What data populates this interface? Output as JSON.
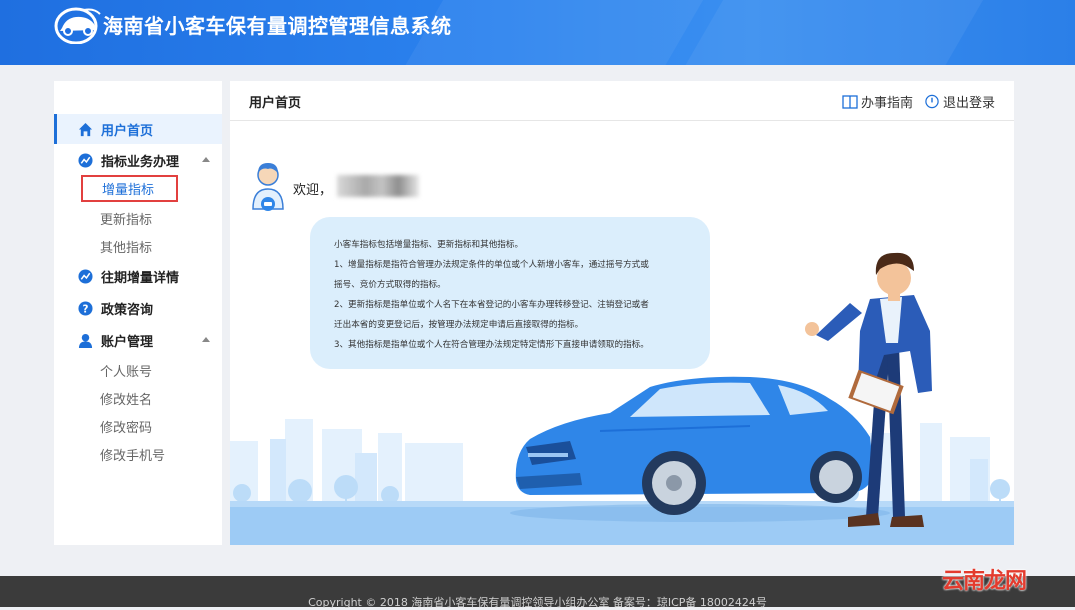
{
  "header": {
    "system_title": "海南省小客车保有量调控管理信息系统"
  },
  "sidebar": {
    "items": [
      {
        "label": "用户首页",
        "icon": "home-icon",
        "active": true
      },
      {
        "label": "指标业务办理",
        "icon": "chart-icon",
        "expanded": true,
        "children": [
          "增量指标",
          "更新指标",
          "其他指标"
        ]
      },
      {
        "label": "往期增量详情",
        "icon": "chart-icon"
      },
      {
        "label": "政策咨询",
        "icon": "question-icon"
      },
      {
        "label": "账户管理",
        "icon": "user-icon",
        "expanded": true,
        "children": [
          "个人账号",
          "修改姓名",
          "修改密码",
          "修改手机号"
        ]
      }
    ]
  },
  "main": {
    "title": "用户首页",
    "guide_label": "办事指南",
    "logout_label": "退出登录",
    "welcome": "欢迎，",
    "info_lines": [
      "小客车指标包括增量指标、更新指标和其他指标。",
      "1、增量指标是指符合管理办法规定条件的单位或个人新增小客车，通过摇号方式或",
      "摇号、竞价方式取得的指标。",
      "2、更新指标是指单位或个人名下在本省登记的小客车办理转移登记、注销登记或者",
      "迁出本省的变更登记后，按管理办法规定申请后直接取得的指标。",
      "3、其他指标是指单位或个人在符合管理办法规定特定情形下直接申请领取的指标。"
    ]
  },
  "footer": {
    "copyright": "Copyright © 2018   海南省小客车保有量调控领导小组办公室    备案号：琼ICP备 18002424号"
  },
  "watermark": "云南龙网",
  "colors": {
    "brand": "#1f6fe0",
    "active": "#1d6fd8",
    "highlight_border": "#e2403f"
  }
}
